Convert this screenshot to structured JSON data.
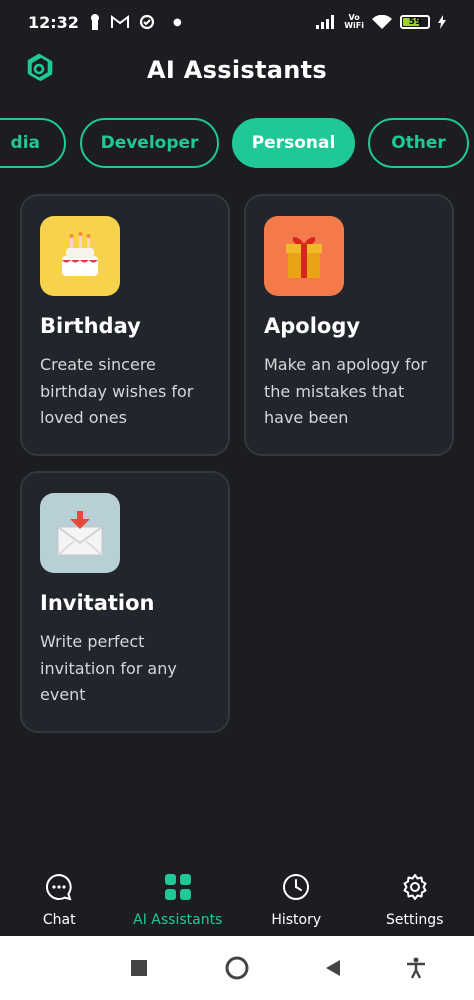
{
  "status_bar": {
    "time": "12:32",
    "volte_top": "Vo",
    "volte_bottom": "WiFi",
    "battery": "59"
  },
  "header": {
    "title": "AI Assistants",
    "logo_icon": "openai-logo-icon"
  },
  "tabs": [
    {
      "label": "dia",
      "active": false
    },
    {
      "label": "Developer",
      "active": false
    },
    {
      "label": "Personal",
      "active": true
    },
    {
      "label": "Other",
      "active": false
    }
  ],
  "cards": [
    {
      "icon": "birthday-cake-icon",
      "title": "Birthday",
      "description": "Create sincere birthday wishes for loved ones",
      "icon_bg": "#f6d34a"
    },
    {
      "icon": "gift-icon",
      "title": "Apology",
      "description": "Make an apology for the mistakes that have been",
      "icon_bg": "#f47a4c"
    },
    {
      "icon": "envelope-icon",
      "title": "Invitation",
      "description": "Write perfect invitation for any event",
      "icon_bg": "#b9cfd6"
    }
  ],
  "bottom_nav": [
    {
      "label": "Chat",
      "icon": "chat-bubble-icon",
      "active": false
    },
    {
      "label": "AI Assistants",
      "icon": "grid-icon",
      "active": true
    },
    {
      "label": "History",
      "icon": "clock-icon",
      "active": false
    },
    {
      "label": "Settings",
      "icon": "gear-icon",
      "active": false
    }
  ],
  "colors": {
    "accent": "#21c897",
    "background": "#1c1d20",
    "card": "#22252b"
  }
}
